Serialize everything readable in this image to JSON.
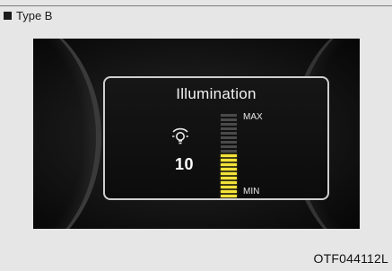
{
  "header": {
    "type_label": "Type B"
  },
  "display": {
    "title": "Illumination",
    "icon": "dashboard-bulb-icon",
    "level_value": "10",
    "max_label": "MAX",
    "min_label": "MIN",
    "level_fraction": 0.5,
    "colors": {
      "active_segment": "#f3e23a",
      "inactive_segment": "#4a4a4a",
      "frame": "#cfcfcf"
    }
  },
  "footer": {
    "figure_code": "OTF044112L"
  }
}
